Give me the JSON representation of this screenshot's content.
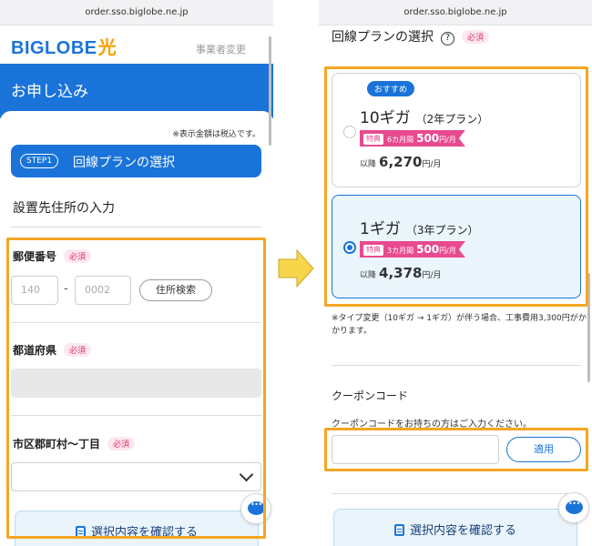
{
  "left": {
    "url": "order.sso.biglobe.ne.jp",
    "logo": {
      "brand": "BIGLOBE",
      "suffix": "光"
    },
    "business_change": "事業者変更",
    "header_title": "お申し込み",
    "tax_note": "※表示金額は税込です。",
    "step": {
      "badge": "STEP1",
      "label": "回線プランの選択"
    },
    "section_title": "設置先住所の入力",
    "required_label": "必須",
    "postal": {
      "label": "郵便番号",
      "part1_placeholder": "140",
      "dash": "-",
      "part2_placeholder": "0002",
      "search_button": "住所検索"
    },
    "prefecture": {
      "label": "都道府県"
    },
    "city": {
      "label": "市区郡町村〜丁目"
    },
    "confirm_button": "選択内容を確認する"
  },
  "right": {
    "url": "order.sso.biglobe.ne.jp",
    "heading": "回線プランの選択",
    "help_icon_glyph": "?",
    "required_label": "必須",
    "plans": [
      {
        "badge": "おすすめ",
        "name": "10ギガ",
        "term": "（2年プラン）",
        "promo_tag": "特典",
        "promo_period": "6カ月間",
        "promo_price": "500",
        "promo_unit": "円/月",
        "after_prefix": "以降",
        "after_price": "6,270",
        "after_unit": "円/月",
        "selected": false
      },
      {
        "name": "1ギガ",
        "term": "（3年プラン）",
        "promo_tag": "特典",
        "promo_period": "3カ月間",
        "promo_price": "500",
        "promo_unit": "円/月",
        "after_prefix": "以降",
        "after_price": "4,378",
        "after_unit": "円/月",
        "selected": true
      }
    ],
    "type_change_note": "※タイプ変更（10ギガ → 1ギガ）が伴う場合、工事費用3,300円がかかります。",
    "coupon": {
      "title": "クーポンコード",
      "description": "クーポンコードをお持ちの方はご入力ください。",
      "input_value": "",
      "apply_button": "適用"
    },
    "confirm_button": "選択内容を確認する"
  },
  "colors": {
    "brand_blue": "#1a73d9",
    "highlight_orange": "#f5a623",
    "promo_pink": "#e84a8f",
    "required_red": "#e0336e",
    "arrow_yellow": "#f7d54a"
  }
}
